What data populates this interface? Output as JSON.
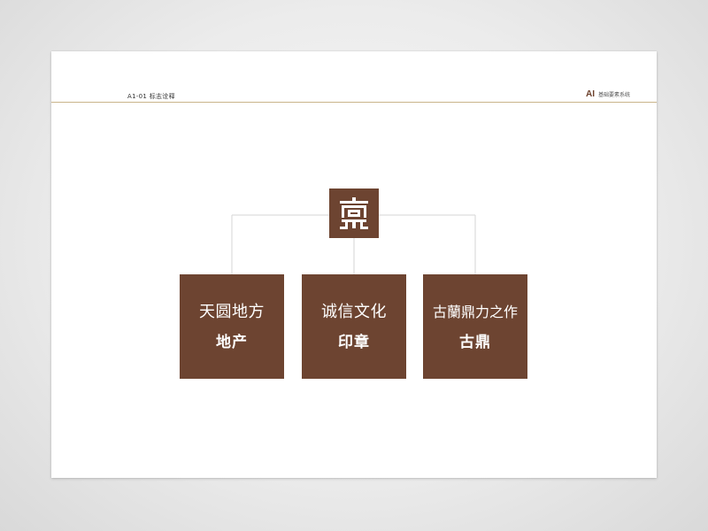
{
  "header": {
    "section_title": "A1-01 标志诠释",
    "code": "AI",
    "category": "基础要素系统"
  },
  "logo": {
    "icon": "ding-seal-logo-icon",
    "color": "#6d4431"
  },
  "cards": [
    {
      "title": "天圆地方",
      "subtitle": "地产"
    },
    {
      "title": "诚信文化",
      "subtitle": "印章"
    },
    {
      "title": "古蘭鼎力之作",
      "subtitle": "古鼎"
    }
  ],
  "colors": {
    "brand_brown": "#6d4431",
    "rule_gold": "#c9b48a",
    "connector": "#d6d6d6"
  }
}
